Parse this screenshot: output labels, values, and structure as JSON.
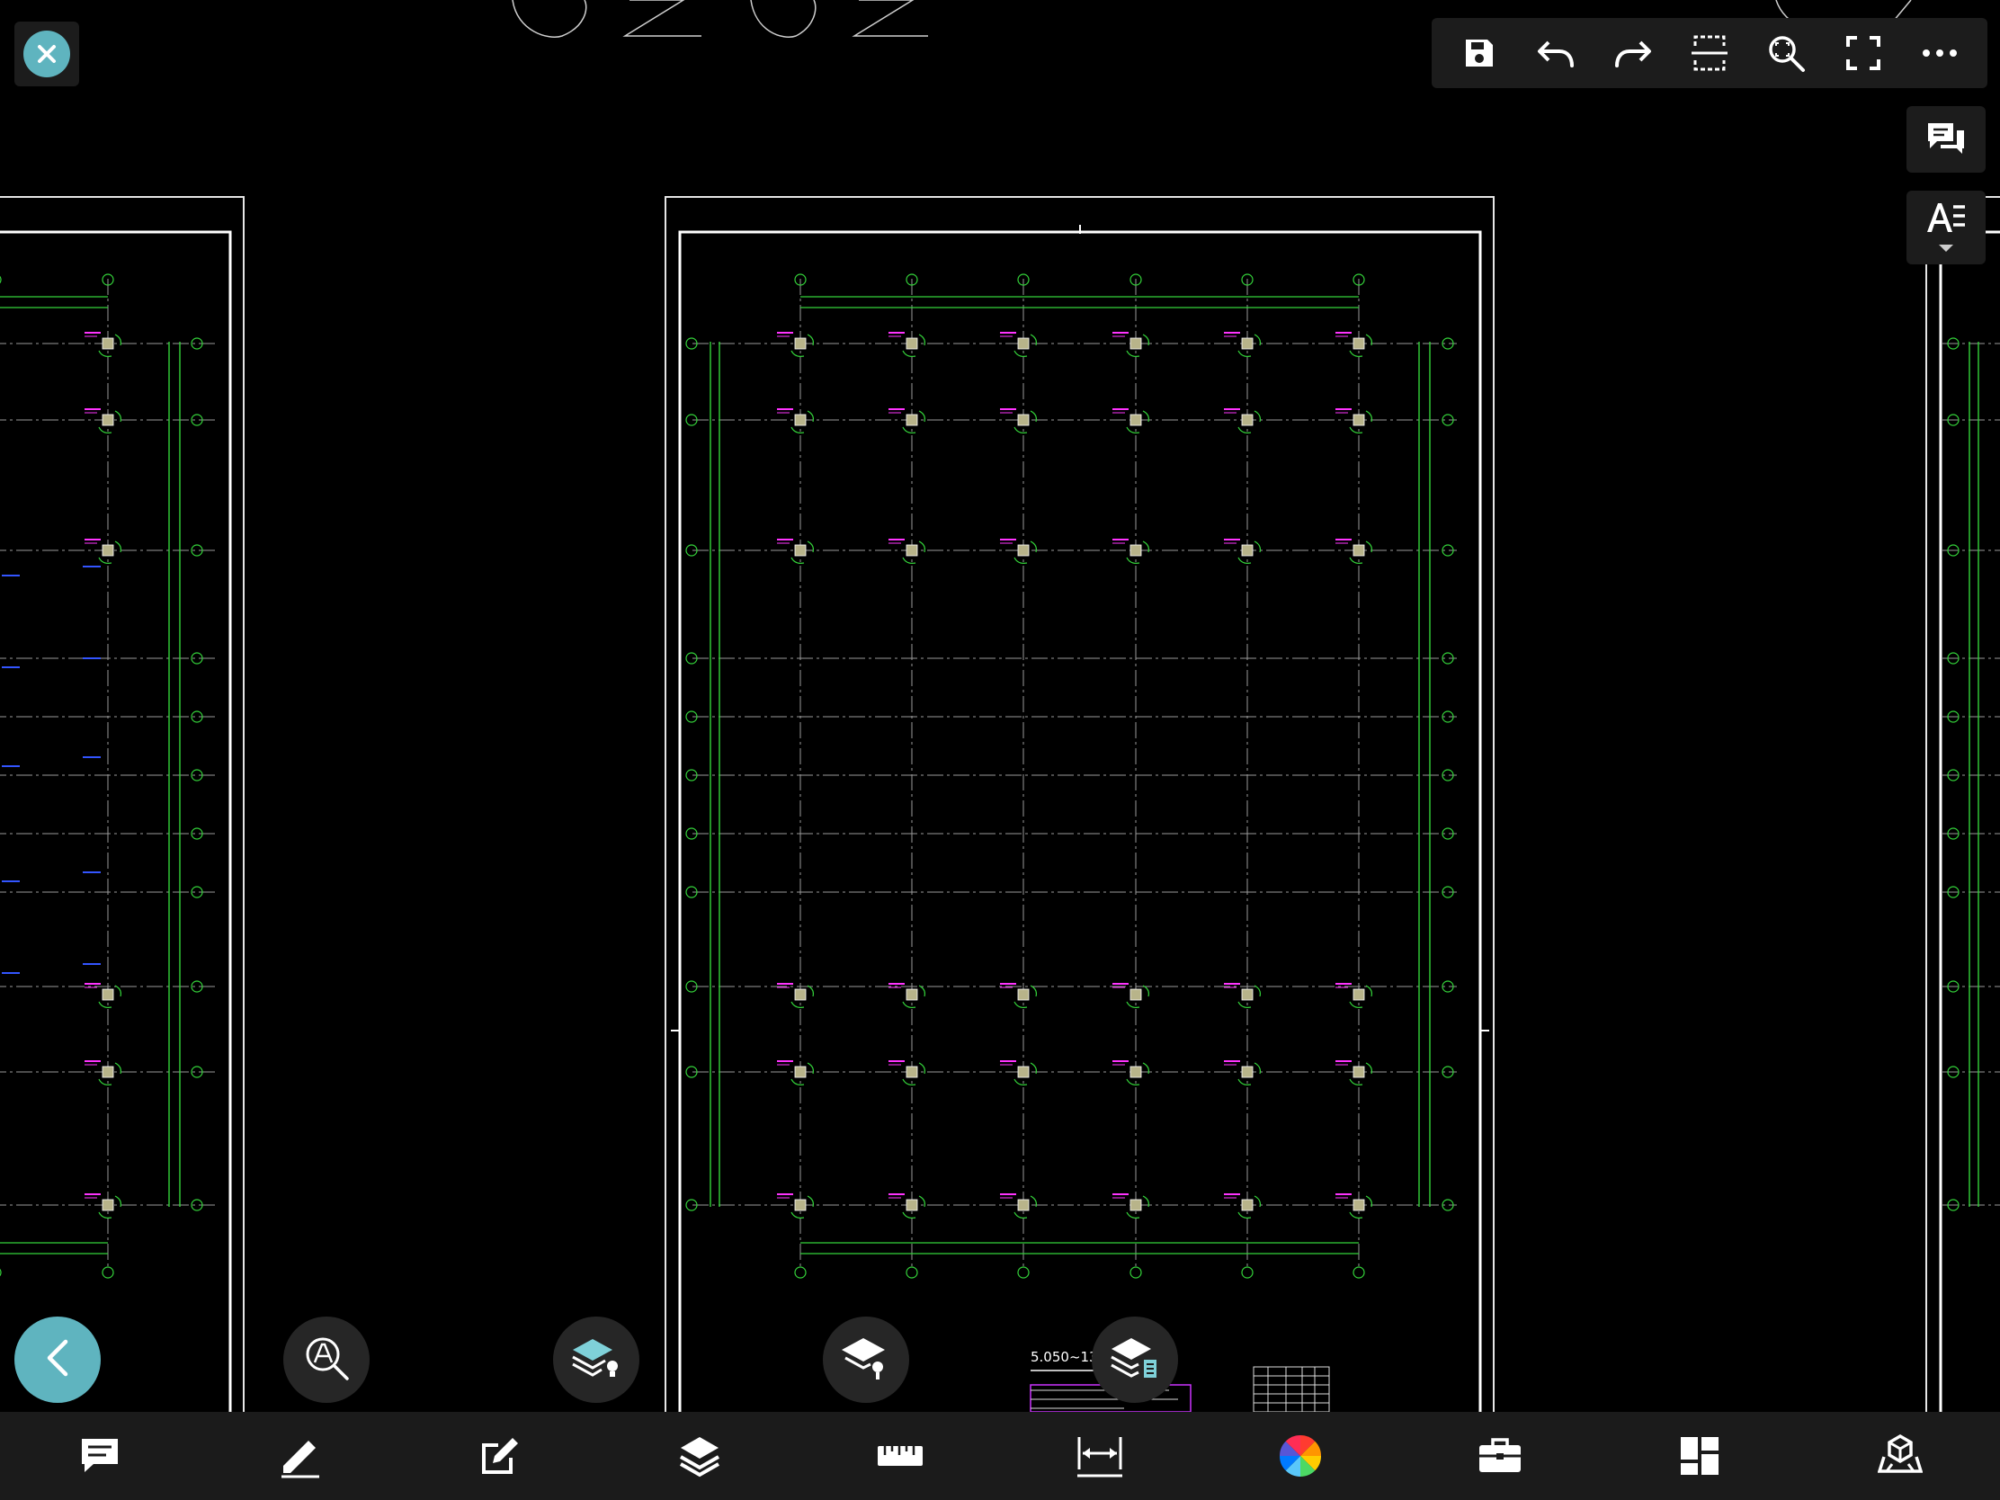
{
  "drawing": {
    "elevation_label": "5.050~13.450"
  },
  "colors": {
    "accent": "#5fb4bf",
    "toolbar_bg": "#1c1c1c",
    "bottombar_bg": "#1b1b1b",
    "grid_green": "#34d33a",
    "annotation_magenta": "#ff33ff",
    "annotation_blue": "#3355ff"
  },
  "top_toolbar": {
    "icons": [
      "save-icon",
      "undo-icon",
      "redo-icon",
      "clip-section-icon",
      "zoom-search-icon",
      "fullscreen-icon",
      "more-icon"
    ]
  },
  "side_panel": {
    "icons": [
      "comments-icon",
      "text-style-icon"
    ]
  },
  "floating_buttons": {
    "icons": [
      "back-chevron-icon",
      "text-search-icon",
      "layer-light-icon",
      "layer-pin-icon",
      "layer-list-icon"
    ]
  },
  "bottom_toolbar": {
    "icons": [
      "comment-icon",
      "pencil-icon",
      "edit-note-icon",
      "layers-icon",
      "ruler-icon",
      "dimension-icon",
      "color-wheel-icon",
      "toolbox-icon",
      "dashboard-icon",
      "viewer-3d-icon"
    ]
  }
}
